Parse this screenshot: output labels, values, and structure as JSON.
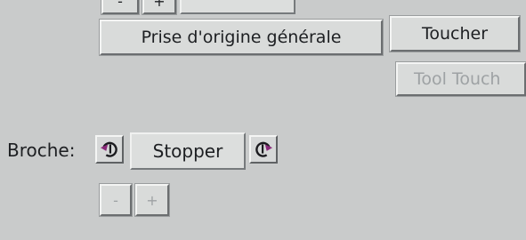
{
  "top_row": {
    "minus_label": "-",
    "plus_label": "+"
  },
  "homing": {
    "home_all_label": "Prise d'origine générale",
    "touch_label": "Toucher",
    "tool_touch_label": "Tool Touch"
  },
  "spindle": {
    "label": "Broche:",
    "state": "Stopper",
    "ccw_icon": "rotate-ccw-icon",
    "cw_icon": "rotate-cw-icon",
    "decrease_label": "-",
    "increase_label": "+"
  }
}
